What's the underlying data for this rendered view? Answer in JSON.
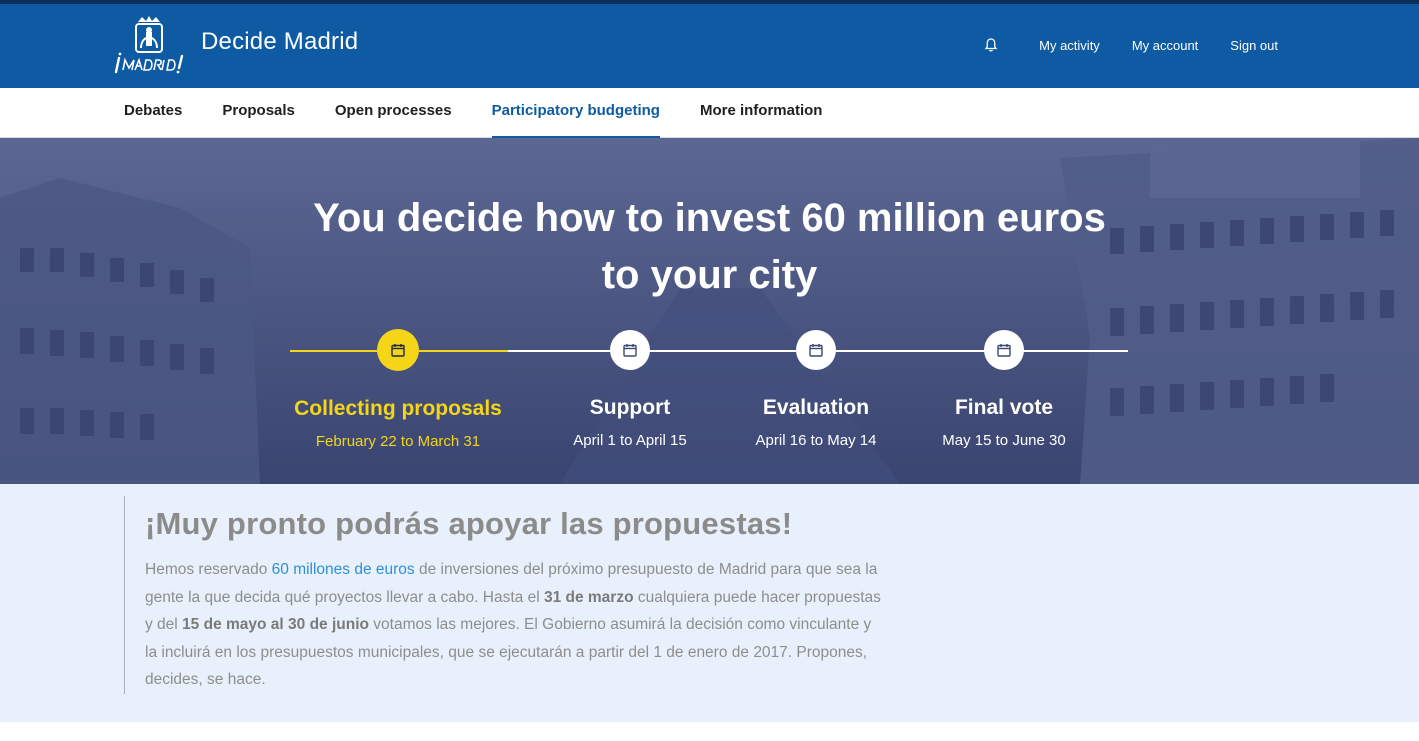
{
  "header": {
    "site_title": "Decide Madrid",
    "logo_text": "¡MADRID!",
    "links": {
      "activity": "My activity",
      "account": "My account",
      "signout": "Sign out"
    },
    "colors": {
      "primary": "#0e5ba3",
      "topline": "#0b2f5a"
    }
  },
  "nav": {
    "items": [
      {
        "label": "Debates"
      },
      {
        "label": "Proposals"
      },
      {
        "label": "Open processes"
      },
      {
        "label": "Participatory budgeting"
      },
      {
        "label": "More information"
      }
    ],
    "active": "Participatory budgeting"
  },
  "hero": {
    "title_line1": "You decide how to invest 60 million euros",
    "title_line2": "to your city",
    "steps": [
      {
        "name": "Collecting proposals",
        "dates": "February 22 to March 31",
        "current": true,
        "icon": "calendar-icon"
      },
      {
        "name": "Support",
        "dates": "April 1 to April 15",
        "current": false,
        "icon": "calendar-icon"
      },
      {
        "name": "Evaluation",
        "dates": "April 16 to May 14",
        "current": false,
        "icon": "calendar-icon"
      },
      {
        "name": "Final vote",
        "dates": "May 15 to June 30",
        "current": false,
        "icon": "calendar-icon"
      }
    ],
    "colors": {
      "overlay": "#4a5680",
      "current": "#f4d517"
    }
  },
  "info": {
    "heading": "¡Muy pronto podrás apoyar las propuestas!",
    "p_part1": "Hemos reservado ",
    "p_link": "60 millones de euros",
    "p_part2": " de inversiones del próximo presupuesto de Madrid para que sea la gente la que decida qué proyectos llevar a cabo. Hasta el ",
    "p_bold1": "31 de marzo",
    "p_part3": " cualquiera puede hacer propuestas y del ",
    "p_bold2": "15 de mayo al 30 de junio",
    "p_part4": " votamos las mejores. El Gobierno asumirá la decisión como vinculante y la incluirá en los presupuestos municipales, que se ejecutarán a partir del 1 de enero de 2017. Propones, decides, se hace.",
    "colors": {
      "background": "#e8f1fb",
      "link": "#2f8fd8"
    }
  }
}
